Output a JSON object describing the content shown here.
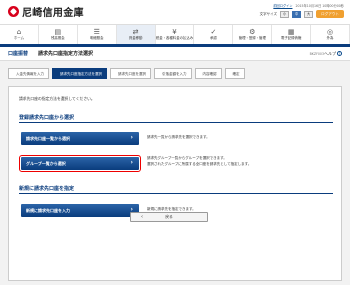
{
  "header": {
    "bank_name": "尼崎信用金庫",
    "prev_login_label": "前回ログイン",
    "last_login": "2015年10月16日 10時00分00秒",
    "text_size_label": "文字サイズ",
    "text_sizes": [
      "小",
      "中",
      "大"
    ],
    "logout_label": "ログアウト"
  },
  "global_nav": [
    {
      "label": "ホーム",
      "icon": "home-icon",
      "glyph": "⌂"
    },
    {
      "label": "残高照会",
      "icon": "bankbook-icon",
      "glyph": "▤"
    },
    {
      "label": "明細照会",
      "icon": "statement-icon",
      "glyph": "☰"
    },
    {
      "label": "資金移動",
      "icon": "transfer-icon",
      "glyph": "⇄"
    },
    {
      "label": "税金・各種料金の払込み",
      "icon": "tax-icon",
      "glyph": "¥"
    },
    {
      "label": "承認",
      "icon": "approval-icon",
      "glyph": "✓"
    },
    {
      "label": "管理・登録・管理",
      "icon": "admin-icon",
      "glyph": "⚙"
    },
    {
      "label": "電子記録債権",
      "icon": "denshi-icon",
      "glyph": "▦"
    },
    {
      "label": "外為",
      "icon": "forex-icon",
      "glyph": "◎"
    }
  ],
  "title_bar": {
    "category": "口座振替",
    "title": "請求先口座指定方法選択",
    "screen_code": "BKZF003",
    "help_label": "ヘルプ"
  },
  "steps": [
    "入金先情報を入力",
    "請求先口座指定方法を選択",
    "請求先口座を選択",
    "引落金額を入力",
    "内容確認",
    "確定"
  ],
  "intro": "請求先口座の指定方法を選択してください。",
  "sections": {
    "registered_title": "登録請求先口座から選択",
    "new_title": "新規に請求先口座を指定"
  },
  "options": {
    "list_select_label": "請求先口座一覧から選択",
    "list_select_desc": "請求先一覧から請求先を選択できます。",
    "group_select_label": "グループ一覧から選択",
    "group_select_desc_1": "請求先グループ一覧からグループを選択できます。",
    "group_select_desc_2": "選択されたグループに所属する全口座を請求先として指定します。",
    "new_input_label": "新規に請求先口座を入力",
    "new_input_desc": "新規に請求先を指定できます。"
  },
  "back_label": "戻る",
  "colors": {
    "brand_red": "#d8001c",
    "nav_blue": "#0a3c7d",
    "highlight_red": "#ee0000",
    "logout_orange": "#f0a030"
  }
}
